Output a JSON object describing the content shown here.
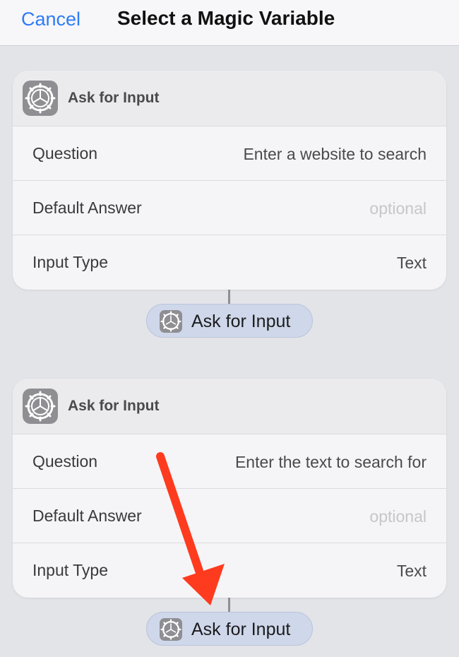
{
  "nav": {
    "cancel_label": "Cancel",
    "title": "Select a Magic Variable"
  },
  "cards": [
    {
      "icon": "settings-gear-icon",
      "title": "Ask for Input",
      "rows": [
        {
          "label": "Question",
          "value": "Enter a website to search",
          "is_placeholder": false
        },
        {
          "label": "Default Answer",
          "value": "optional",
          "is_placeholder": true
        },
        {
          "label": "Input Type",
          "value": "Text",
          "is_placeholder": false
        }
      ],
      "variable_pill": {
        "icon": "settings-gear-icon",
        "label": "Ask for Input"
      }
    },
    {
      "icon": "settings-gear-icon",
      "title": "Ask for Input",
      "rows": [
        {
          "label": "Question",
          "value": "Enter the text to search for",
          "is_placeholder": false
        },
        {
          "label": "Default Answer",
          "value": "optional",
          "is_placeholder": true
        },
        {
          "label": "Input Type",
          "value": "Text",
          "is_placeholder": false
        }
      ],
      "variable_pill": {
        "icon": "settings-gear-icon",
        "label": "Ask for Input"
      }
    }
  ],
  "annotation": {
    "icon": "red-arrow-icon",
    "color": "#ff3b1f"
  },
  "colors": {
    "accent": "#2e7cf6",
    "pill_background": "#cfd8ea",
    "icon_gray": "#8e8e93"
  }
}
